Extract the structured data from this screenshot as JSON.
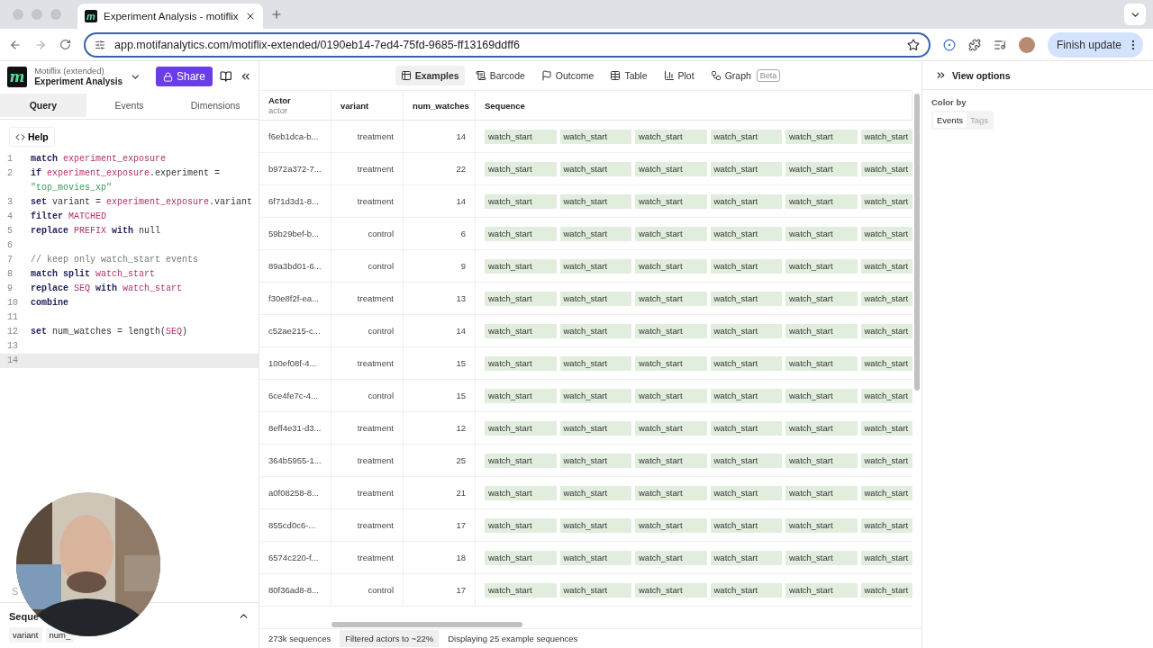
{
  "browser": {
    "tab_logo": "m",
    "tab_title": "Experiment Analysis - motiflix",
    "url": "app.motifanalytics.com/motiflix-extended/0190eb14-7ed4-75fd-9685-ff13169ddff6",
    "update_button": "Finish update"
  },
  "app": {
    "logo": "m",
    "workspace": "Motiflix (extended)",
    "title": "Experiment Analysis",
    "share_button": "Share"
  },
  "left_tabs": [
    {
      "label": "Query",
      "selected": true
    },
    {
      "label": "Events",
      "selected": false
    },
    {
      "label": "Dimensions",
      "selected": false
    }
  ],
  "help_button": "Help",
  "code": [
    {
      "number": "1",
      "active": false,
      "tokens": [
        {
          "kind": "kw",
          "text": "match"
        },
        {
          "kind": "id",
          "text": " experiment_exposure"
        }
      ]
    },
    {
      "number": "2",
      "active": false,
      "tokens": [
        {
          "kind": "kw",
          "text": "if"
        },
        {
          "kind": "id",
          "text": " experiment_exposure"
        },
        {
          "kind": "plain",
          "text": ".experiment ="
        },
        {
          "kind": "str",
          "text": " \"top_movies_xp\""
        }
      ]
    },
    {
      "number": "3",
      "active": false,
      "tokens": [
        {
          "kind": "kw",
          "text": "set"
        },
        {
          "kind": "plain",
          "text": " variant = "
        },
        {
          "kind": "id",
          "text": "experiment_exposure"
        },
        {
          "kind": "plain",
          "text": ".variant"
        }
      ]
    },
    {
      "number": "4",
      "active": false,
      "tokens": [
        {
          "kind": "kw",
          "text": "filter"
        },
        {
          "kind": "id",
          "text": " MATCHED"
        }
      ]
    },
    {
      "number": "5",
      "active": false,
      "tokens": [
        {
          "kind": "kw",
          "text": "replace"
        },
        {
          "kind": "id",
          "text": " PREFIX"
        },
        {
          "kind": "kw",
          "text": " with"
        },
        {
          "kind": "plain",
          "text": " null"
        }
      ]
    },
    {
      "number": "6",
      "active": false
    },
    {
      "number": "7",
      "active": false,
      "tokens": [
        {
          "kind": "comment",
          "text": "// keep only watch_start events"
        }
      ]
    },
    {
      "number": "8",
      "active": false,
      "tokens": [
        {
          "kind": "kw",
          "text": "match split"
        },
        {
          "kind": "id",
          "text": " watch_start"
        }
      ]
    },
    {
      "number": "9",
      "active": false,
      "tokens": [
        {
          "kind": "kw",
          "text": "replace"
        },
        {
          "kind": "id",
          "text": " SEQ"
        },
        {
          "kind": "kw",
          "text": " with"
        },
        {
          "kind": "id",
          "text": " watch_start"
        }
      ]
    },
    {
      "number": "10",
      "active": false,
      "tokens": [
        {
          "kind": "kw",
          "text": "combine"
        }
      ]
    },
    {
      "number": "11",
      "active": false
    },
    {
      "number": "12",
      "active": false,
      "tokens": [
        {
          "kind": "kw",
          "text": "set"
        },
        {
          "kind": "plain",
          "text": " num_watches = length("
        },
        {
          "kind": "id",
          "text": "SEQ"
        },
        {
          "kind": "plain",
          "text": ")"
        }
      ]
    },
    {
      "number": "13",
      "active": false
    },
    {
      "number": "14",
      "active": true
    }
  ],
  "hidden_label": "S",
  "sequence_panel": {
    "title": "Seque",
    "chips": [
      "variant",
      "num_"
    ]
  },
  "view_tabs": [
    {
      "label": "Examples",
      "selected": true
    },
    {
      "label": "Barcode",
      "selected": false
    },
    {
      "label": "Outcome",
      "selected": false
    },
    {
      "label": "Table",
      "selected": false
    },
    {
      "label": "Plot",
      "selected": false
    },
    {
      "label": "Graph",
      "selected": false,
      "badge": "Beta"
    }
  ],
  "table": {
    "columns": [
      {
        "label": "Actor",
        "sub": "actor"
      },
      {
        "label": "variant"
      },
      {
        "label": "num_watches"
      },
      {
        "label": "Sequence"
      }
    ],
    "rows": [
      {
        "actor": "f6eb1dca-b...",
        "variant": "treatment",
        "num_watches": "14",
        "sequence": [
          "watch_start",
          "watch_start",
          "watch_start",
          "watch_start",
          "watch_start",
          "watch_start"
        ]
      },
      {
        "actor": "b972a372-7...",
        "variant": "treatment",
        "num_watches": "22",
        "sequence": [
          "watch_start",
          "watch_start",
          "watch_start",
          "watch_start",
          "watch_start",
          "watch_start"
        ]
      },
      {
        "actor": "6f71d3d1-8...",
        "variant": "treatment",
        "num_watches": "14",
        "sequence": [
          "watch_start",
          "watch_start",
          "watch_start",
          "watch_start",
          "watch_start",
          "watch_start"
        ]
      },
      {
        "actor": "59b29bef-b...",
        "variant": "control",
        "num_watches": "6",
        "sequence": [
          "watch_start",
          "watch_start",
          "watch_start",
          "watch_start",
          "watch_start",
          "watch_start"
        ]
      },
      {
        "actor": "89a3bd01-6...",
        "variant": "control",
        "num_watches": "9",
        "sequence": [
          "watch_start",
          "watch_start",
          "watch_start",
          "watch_start",
          "watch_start",
          "watch_start"
        ]
      },
      {
        "actor": "f30e8f2f-ea...",
        "variant": "treatment",
        "num_watches": "13",
        "sequence": [
          "watch_start",
          "watch_start",
          "watch_start",
          "watch_start",
          "watch_start",
          "watch_start"
        ]
      },
      {
        "actor": "c52ae215-c...",
        "variant": "control",
        "num_watches": "14",
        "sequence": [
          "watch_start",
          "watch_start",
          "watch_start",
          "watch_start",
          "watch_start",
          "watch_start"
        ]
      },
      {
        "actor": "100ef08f-4...",
        "variant": "treatment",
        "num_watches": "15",
        "sequence": [
          "watch_start",
          "watch_start",
          "watch_start",
          "watch_start",
          "watch_start",
          "watch_start"
        ]
      },
      {
        "actor": "6ce4fe7c-4...",
        "variant": "control",
        "num_watches": "15",
        "sequence": [
          "watch_start",
          "watch_start",
          "watch_start",
          "watch_start",
          "watch_start",
          "watch_start"
        ]
      },
      {
        "actor": "8eff4e31-d3...",
        "variant": "treatment",
        "num_watches": "12",
        "sequence": [
          "watch_start",
          "watch_start",
          "watch_start",
          "watch_start",
          "watch_start",
          "watch_start"
        ]
      },
      {
        "actor": "364b5955-1...",
        "variant": "treatment",
        "num_watches": "25",
        "sequence": [
          "watch_start",
          "watch_start",
          "watch_start",
          "watch_start",
          "watch_start",
          "watch_start"
        ]
      },
      {
        "actor": "a0f08258-8...",
        "variant": "treatment",
        "num_watches": "21",
        "sequence": [
          "watch_start",
          "watch_start",
          "watch_start",
          "watch_start",
          "watch_start",
          "watch_start"
        ]
      },
      {
        "actor": "855cd0c6-...",
        "variant": "treatment",
        "num_watches": "17",
        "sequence": [
          "watch_start",
          "watch_start",
          "watch_start",
          "watch_start",
          "watch_start",
          "watch_start"
        ]
      },
      {
        "actor": "6574c220-f...",
        "variant": "treatment",
        "num_watches": "18",
        "sequence": [
          "watch_start",
          "watch_start",
          "watch_start",
          "watch_start",
          "watch_start",
          "watch_start"
        ]
      },
      {
        "actor": "80f36ad8-8...",
        "variant": "control",
        "num_watches": "17",
        "sequence": [
          "watch_start",
          "watch_start",
          "watch_start",
          "watch_start",
          "watch_start",
          "watch_start"
        ]
      }
    ]
  },
  "status_bar": [
    {
      "text": "273k sequences",
      "highlighted": false
    },
    {
      "text": "Filtered actors to ~22%",
      "highlighted": true
    },
    {
      "text": "Displaying 25 example sequences",
      "highlighted": false
    }
  ],
  "view_options": {
    "title": "View options",
    "color_by_label": "Color by",
    "color_by": [
      {
        "label": "Events",
        "selected": true
      },
      {
        "label": "Tags",
        "selected": false
      }
    ]
  }
}
